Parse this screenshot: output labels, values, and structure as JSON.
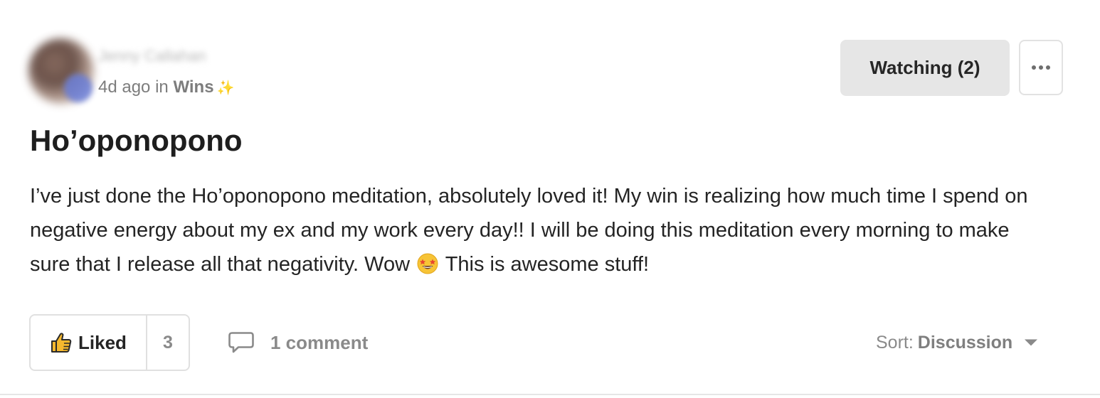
{
  "post": {
    "author_name": "Jenny Callahan",
    "time_ago": "4d ago",
    "in_word": "in",
    "category": "Wins",
    "category_emoji": "✨",
    "title": "Ho’oponopono",
    "body_part1": "I’ve just done the Ho’oponopono meditation, absolutely loved it! My win is realizing how much time I spend on negative energy about my ex and my work every day!! I will be doing this meditation every morning to make sure that I release all that negativity. Wow",
    "body_part2": "This is awesome stuff!"
  },
  "header": {
    "watch_label": "Watching (2)"
  },
  "footer": {
    "like_label": "Liked",
    "like_count": "3",
    "comment_label": "1 comment",
    "sort_prefix": "Sort:",
    "sort_value": "Discussion"
  },
  "icons": {
    "more": "more-horizontal-icon",
    "like": "thumbs-up-icon",
    "comment": "speech-bubble-icon",
    "caret": "caret-down-icon",
    "emoji": "star-struck-emoji"
  },
  "colors": {
    "button_bg": "#e6e6e6",
    "border": "#e0e0e0",
    "muted_text": "#8a8a8a",
    "like_icon": "#f5b82e"
  }
}
